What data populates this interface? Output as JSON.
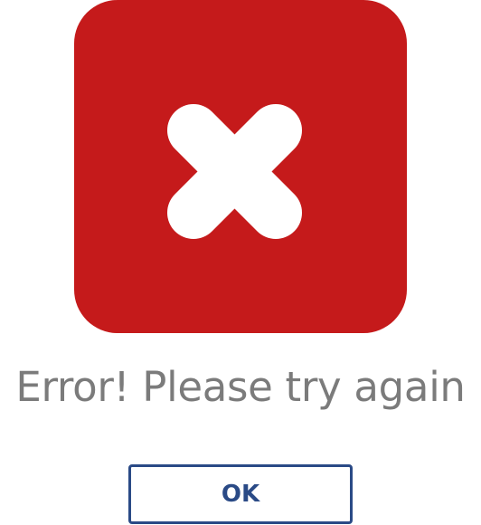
{
  "dialog": {
    "icon": "error-x-icon",
    "message": "Error! Please try again",
    "ok_label": "OK"
  },
  "colors": {
    "error_red": "#c51a1b",
    "message_gray": "#7b7b7b",
    "button_blue": "#2a4a86",
    "icon_white": "#ffffff"
  }
}
